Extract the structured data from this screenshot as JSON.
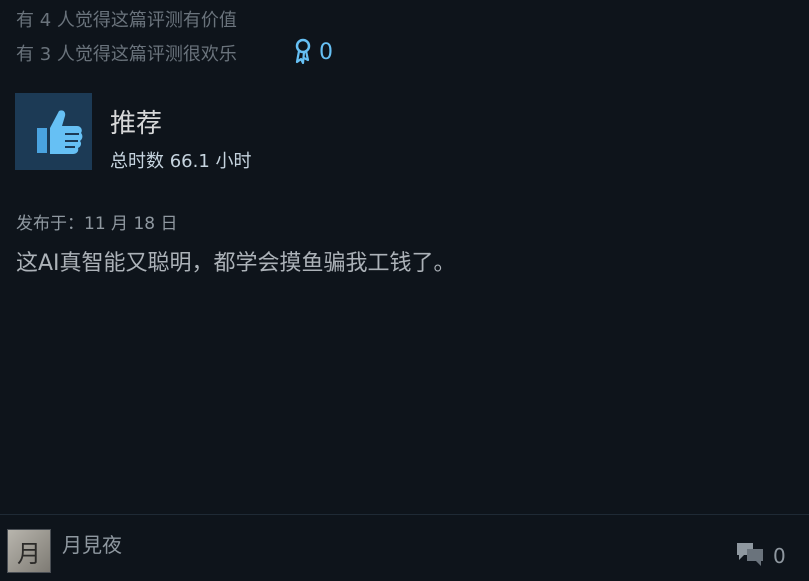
{
  "helpful": {
    "line1": "有 4 人觉得这篇评测有价值",
    "line2": "有 3 人觉得这篇评测很欢乐"
  },
  "award": {
    "count": "0",
    "icon": "award-ribbon-icon",
    "color": "#66c0f4"
  },
  "recommendation": {
    "title": "推荐",
    "hours": "总时数 66.1 小时",
    "icon": "thumbs-up-icon"
  },
  "review": {
    "posted": "发布于：11 月 18 日",
    "text": "这AI真智能又聪明，都学会摸鱼骗我工钱了。"
  },
  "author": {
    "name": "月見夜",
    "avatar_glyph": "月"
  },
  "comments": {
    "count": "0",
    "icon": "comments-icon"
  }
}
